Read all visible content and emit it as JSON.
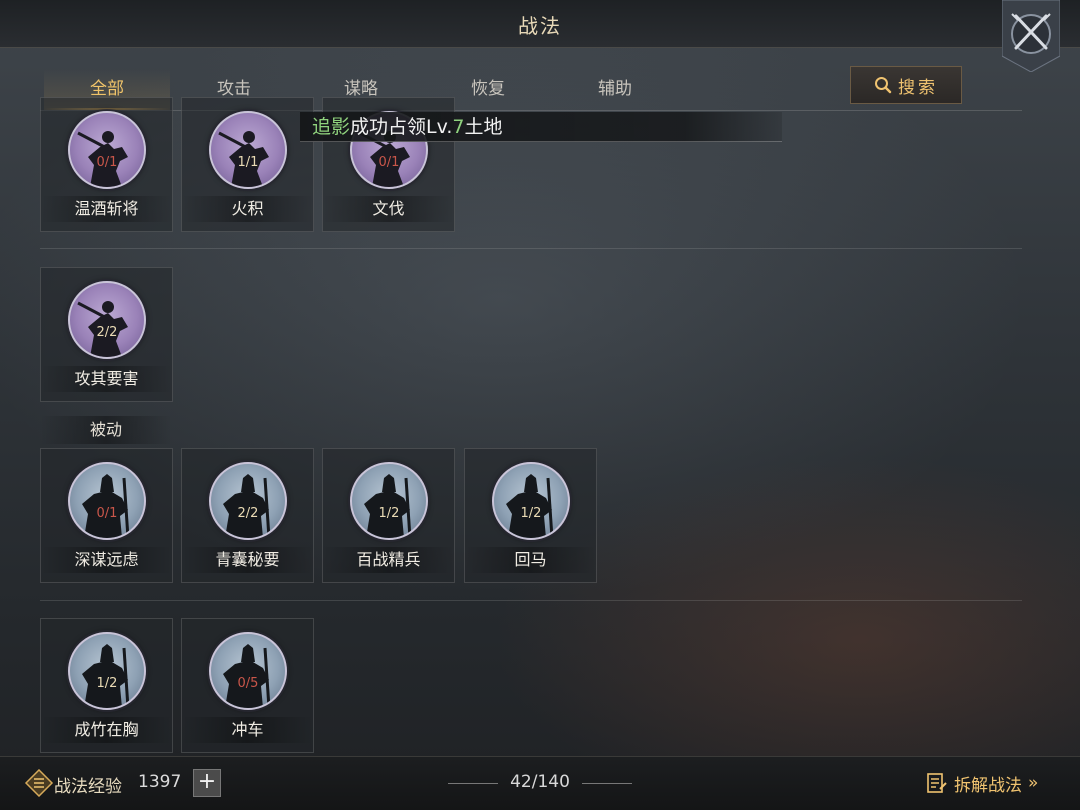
{
  "header": {
    "title": "战法"
  },
  "tabs": [
    {
      "label": "全部",
      "active": true
    },
    {
      "label": "攻击",
      "active": false
    },
    {
      "label": "谋略",
      "active": false
    },
    {
      "label": "恢复",
      "active": false
    },
    {
      "label": "辅助",
      "active": false
    }
  ],
  "search": {
    "label": "搜索",
    "icon": "search-icon"
  },
  "banner": {
    "prefix": "追影",
    "middle": "成功占领Lv.",
    "level": "7",
    "suffix": "土地"
  },
  "active_cards": [
    {
      "name": "温酒斩将",
      "count": "0/1",
      "count_color": "red",
      "icon": "purple-warrior-icon"
    },
    {
      "name": "火积",
      "count": "1/1",
      "count_color": "normal",
      "icon": "purple-warrior-icon"
    },
    {
      "name": "文伐",
      "count": "0/1",
      "count_color": "red",
      "icon": "purple-warrior-icon"
    },
    {
      "name": "攻其要害",
      "count": "2/2",
      "count_color": "normal",
      "icon": "purple-warrior-icon"
    }
  ],
  "passive_section": {
    "label": "被动"
  },
  "passive_cards": [
    {
      "name": "深谋远虑",
      "count": "0/1",
      "count_color": "red",
      "icon": "blue-armored-warrior-icon"
    },
    {
      "name": "青囊秘要",
      "count": "2/2",
      "count_color": "normal",
      "icon": "blue-armored-warrior-icon"
    },
    {
      "name": "百战精兵",
      "count": "1/2",
      "count_color": "normal",
      "icon": "blue-armored-warrior-icon"
    },
    {
      "name": "回马",
      "count": "1/2",
      "count_color": "normal",
      "icon": "blue-armored-warrior-icon"
    },
    {
      "name": "成竹在胸",
      "count": "1/2",
      "count_color": "normal",
      "icon": "blue-armored-warrior-icon"
    },
    {
      "name": "冲车",
      "count": "0/5",
      "count_color": "red",
      "icon": "blue-armored-warrior-icon"
    }
  ],
  "footer": {
    "exp_label": "战法经验",
    "exp_value": "1397",
    "plus": "+",
    "page_count": "42/140",
    "disassemble_label": "拆解战法",
    "disassemble_arrow": "»"
  },
  "colors": {
    "accent_gold": "#f0c370",
    "count_red": "#c9564a",
    "banner_green": "#8fd27d"
  }
}
